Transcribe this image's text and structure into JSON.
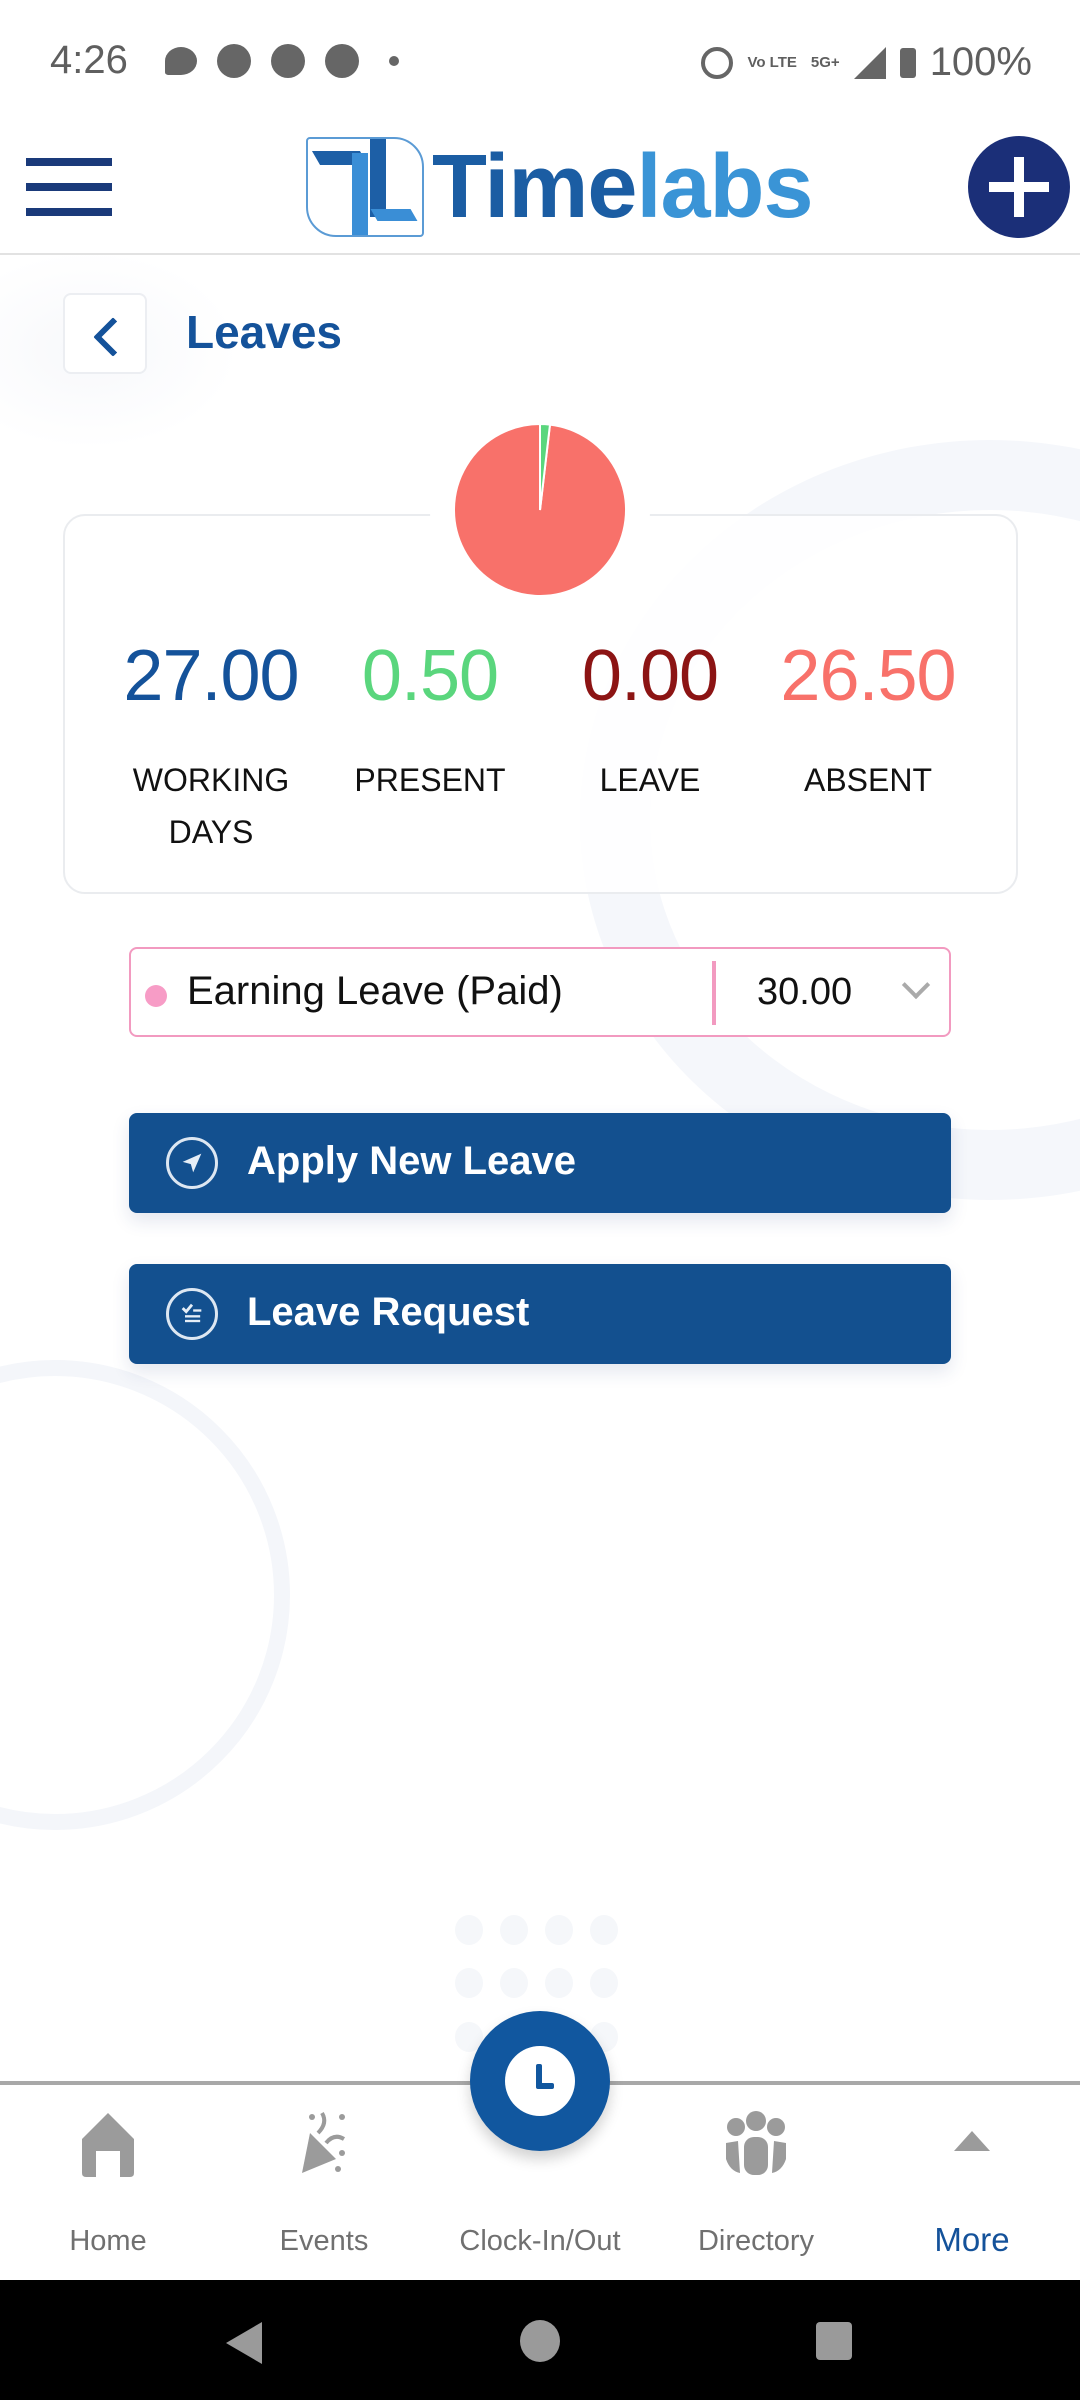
{
  "status_bar": {
    "time": "4:26",
    "notification_icons": [
      "messages-icon",
      "cat-app-icon",
      "paytm-icon",
      "phone-app-icon",
      "more-dot-icon"
    ],
    "system_icons": [
      "alarm-icon",
      "volte-icon",
      "5g-icon",
      "signal-icon",
      "battery-charging-icon"
    ],
    "volte_label": "Vo LTE",
    "network_label": "5G+",
    "battery": "100%"
  },
  "header": {
    "logo_text_1": "Time",
    "logo_text_2": "labs",
    "brand_color": "#1b5da3",
    "accent_color": "#3a94d6"
  },
  "page": {
    "title": "Leaves"
  },
  "summary": {
    "chart": {
      "type": "pie",
      "slices": [
        {
          "name": "Absent",
          "value": 26.5,
          "color": "#f8716a"
        },
        {
          "name": "Present",
          "value": 0.5,
          "color": "#5ad67d"
        },
        {
          "name": "Leave",
          "value": 0.0,
          "color": "#8c1414"
        }
      ],
      "remainder_color": "#12508f",
      "remainder_name": "Working Days"
    },
    "stats": [
      {
        "value": "27.00",
        "label": "WORKING\nDAYS",
        "color": "#14529a"
      },
      {
        "value": "0.50",
        "label": "PRESENT",
        "color": "#5ad67d"
      },
      {
        "value": "0.00",
        "label": "LEAVE",
        "color": "#8c1414"
      },
      {
        "value": "26.50",
        "label": "ABSENT",
        "color": "#f8716a"
      }
    ]
  },
  "leave_type": {
    "selected": "Earning Leave (Paid)",
    "balance": "30.00",
    "dot_color": "#f79cc6"
  },
  "actions": {
    "apply_label": "Apply New Leave",
    "request_label": "Leave Request"
  },
  "bottom_nav": {
    "items": [
      {
        "label": "Home",
        "icon": "home-icon",
        "active": false
      },
      {
        "label": "Events",
        "icon": "party-popper-icon",
        "active": false
      },
      {
        "label": "Clock-In/Out",
        "icon": "clock-icon",
        "active": false
      },
      {
        "label": "Directory",
        "icon": "people-icon",
        "active": false
      },
      {
        "label": "More",
        "icon": "caret-up-icon",
        "active": true
      }
    ]
  }
}
